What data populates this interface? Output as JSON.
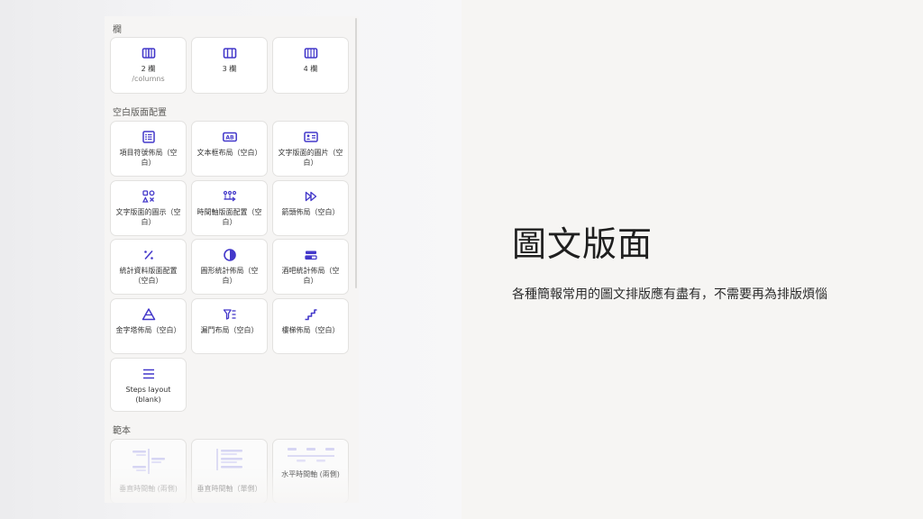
{
  "panel": {
    "sections": {
      "columns": "欄",
      "blank_layouts": "空白版面配置",
      "templates": "範本"
    },
    "column_cards": [
      {
        "label": "2 欄",
        "sub": "/columns"
      },
      {
        "label": "3 欄"
      },
      {
        "label": "4 欄"
      }
    ],
    "layout_cards": [
      {
        "label": "項目符號佈局（空白）",
        "icon": "bullet-list-icon"
      },
      {
        "label": "文本框布局（空白）",
        "icon": "textbox-ab-icon"
      },
      {
        "label": "文字版面的圖片（空白）",
        "icon": "image-card-icon"
      },
      {
        "label": "文字版面的圖示（空白）",
        "icon": "icon-grid-icon"
      },
      {
        "label": "時間軸版面配置（空白）",
        "icon": "timeline-icon"
      },
      {
        "label": "箭頭佈局（空白）",
        "icon": "arrows-icon"
      },
      {
        "label": "統計資料版面配置（空白）",
        "icon": "percent-icon"
      },
      {
        "label": "圓形統計佈局（空白）",
        "icon": "pie-icon"
      },
      {
        "label": "酒吧統計佈局（空白）",
        "icon": "bars-icon"
      },
      {
        "label": "金字塔佈局（空白）",
        "icon": "pyramid-icon"
      },
      {
        "label": "漏鬥布局（空白）",
        "icon": "funnel-icon"
      },
      {
        "label": "樓梯佈局（空白）",
        "icon": "stairs-icon"
      },
      {
        "label": "Steps layout (blank)",
        "icon": "steps-icon"
      }
    ],
    "template_cards": [
      {
        "label": "垂直時間軸 (兩側)"
      },
      {
        "label": "垂直時間軸（單側）"
      },
      {
        "label": "水平時間軸 (兩側)"
      }
    ],
    "accent_color": "#4338ca"
  },
  "slide": {
    "title": "圖文版面",
    "subtitle": "各種簡報常用的圖文排版應有盡有，不需要再為排版煩惱"
  }
}
